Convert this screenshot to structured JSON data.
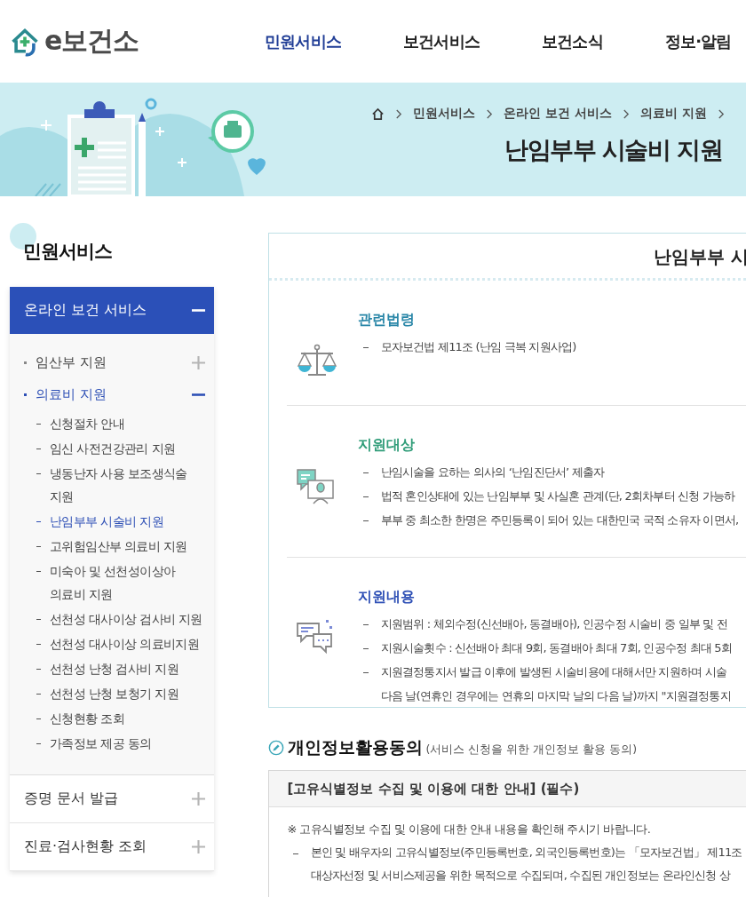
{
  "header": {
    "logo": "e보건소",
    "nav": [
      {
        "label": "민원서비스",
        "selected": true
      },
      {
        "label": "보건서비스",
        "selected": false
      },
      {
        "label": "보건소식",
        "selected": false
      },
      {
        "label": "정보·알림",
        "selected": false
      }
    ]
  },
  "banner": {
    "breadcrumb": [
      "민원서비스",
      "온라인 보건 서비스",
      "의료비 지원"
    ],
    "title": "난임부부 시술비 지원"
  },
  "sidebar": {
    "title": "민원서비스",
    "groups": [
      {
        "label": "온라인 보건 서비스",
        "expanded": true,
        "children": [
          {
            "label": "임산부 지원",
            "expanded": false,
            "selected": false
          },
          {
            "label": "의료비 지원",
            "expanded": true,
            "selected": true,
            "children": [
              {
                "label": "신청절차 안내",
                "selected": false
              },
              {
                "label": "임신 사전건강관리 지원",
                "selected": false
              },
              {
                "label": "냉동난자 사용 보조생식술 지원",
                "selected": false
              },
              {
                "label": "난임부부 시술비 지원",
                "selected": true
              },
              {
                "label": "고위험임산부 의료비 지원",
                "selected": false
              },
              {
                "label": "미숙아 및 선천성이상아 의료비 지원",
                "selected": false
              },
              {
                "label": "선천성 대사이상 검사비 지원",
                "selected": false
              },
              {
                "label": "선천성 대사이상 의료비지원",
                "selected": false
              },
              {
                "label": "선천성 난청 검사비 지원",
                "selected": false
              },
              {
                "label": "선천성 난청 보청기 지원",
                "selected": false
              },
              {
                "label": "신청현황 조회",
                "selected": false
              },
              {
                "label": "가족정보 제공 동의",
                "selected": false
              }
            ]
          }
        ]
      },
      {
        "label": "증명 문서 발급",
        "expanded": false
      },
      {
        "label": "진료·검사현황 조회",
        "expanded": false
      }
    ]
  },
  "info_card": {
    "title": "난임부부 시",
    "sections": [
      {
        "title": "관련법령",
        "color": "#2a87a8",
        "bullets": [
          [
            "모자보건법 제11조 (난임 극복 지원사업)"
          ]
        ]
      },
      {
        "title": "지원대상",
        "color": "#2f9c78",
        "bullets": [
          [
            "난임시술을 요하는 의사의 ‘난임진단서’ 제출자"
          ],
          [
            "법적 혼인상태에 있는 난임부부 및 사실혼 관계(단, 2회차부터 신청 가능하"
          ],
          [
            "부부 중 최소한 한명은 주민등록이 되어 있는 대한민국 국적 소유자 이면서,"
          ]
        ]
      },
      {
        "title": "지원내용",
        "color": "#2d4fb5",
        "bullets": [
          [
            "지원범위 : 체외수정(신선배아, 동결배아), 인공수정 시술비 중 일부 및 전"
          ],
          [
            "지원시술횟수 :  신선배아 최대 9회, 동결배아 최대 7회, 인공수정 최대 5회"
          ],
          [
            "지원결정통지서 발급 이후에 발생된 시술비용에 대해서만 지원하며 시술",
            "다음 날(연휴인 경우에는 연휴의 마지막 날의 다음 날)까지 \"지원결정통지"
          ]
        ]
      }
    ]
  },
  "consent": {
    "title": "개인정보활용동의",
    "subtitle": "(서비스 신청을 위한 개인정보 활용 동의)",
    "box_title": "[고유식별정보 수집 및 이용에 대한 안내] (필수)",
    "notice": "※ 고유식별정보 수집 및 이용에 대한 안내 내용을 확인해 주시기 바랍니다.",
    "bullets": [
      [
        "본인 및 배우자의 고유식별정보(주민등록번호, 외국인등록번호)는 「모자보건법」 제11조",
        "대상자선정 및 서비스제공을 위한 목적으로 수집되며, 수집된 개인정보는 온라인신청 상"
      ]
    ]
  }
}
